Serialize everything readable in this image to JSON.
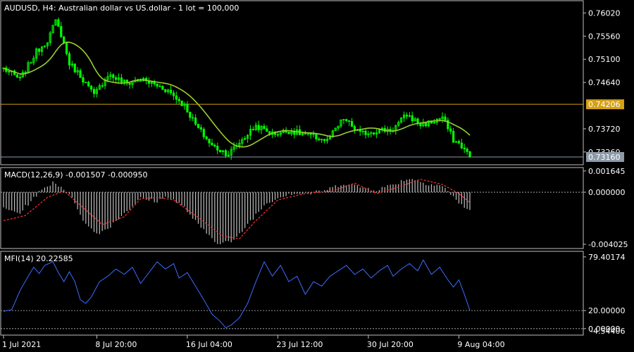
{
  "chart_data": [
    {
      "type": "candlestick",
      "title": "AUDUSD, H4:  Australian dollar vs US.dollar - 1 lot = 100,000",
      "price_ticks": [
        "0.76020",
        "0.75560",
        "0.75100",
        "0.74640",
        "0.73720",
        "0.73260"
      ],
      "price_tick_values": [
        0.7602,
        0.7556,
        0.751,
        0.7464,
        0.7372,
        0.7326
      ],
      "ylim": [
        0.7302,
        0.7625
      ],
      "marker_line": {
        "value": 0.74206,
        "label": "0.74206",
        "color": "#d4a017"
      },
      "current_price": {
        "value": 0.7316,
        "label": "0.73160",
        "color": "#8c9aa8"
      },
      "candle_color": "#00ff00",
      "ma_color": "#9acd32",
      "anchors": [
        {
          "i": 0,
          "p": 0.7492
        },
        {
          "i": 6,
          "p": 0.747
        },
        {
          "i": 12,
          "p": 0.7525
        },
        {
          "i": 16,
          "p": 0.7548
        },
        {
          "i": 19,
          "p": 0.7585
        },
        {
          "i": 21,
          "p": 0.756
        },
        {
          "i": 24,
          "p": 0.7502
        },
        {
          "i": 28,
          "p": 0.7478
        },
        {
          "i": 33,
          "p": 0.7438
        },
        {
          "i": 38,
          "p": 0.748
        },
        {
          "i": 45,
          "p": 0.7462
        },
        {
          "i": 50,
          "p": 0.747
        },
        {
          "i": 56,
          "p": 0.7458
        },
        {
          "i": 60,
          "p": 0.7448
        },
        {
          "i": 66,
          "p": 0.7418
        },
        {
          "i": 70,
          "p": 0.738
        },
        {
          "i": 76,
          "p": 0.7338
        },
        {
          "i": 82,
          "p": 0.7322
        },
        {
          "i": 86,
          "p": 0.7345
        },
        {
          "i": 92,
          "p": 0.7378
        },
        {
          "i": 98,
          "p": 0.7362
        },
        {
          "i": 104,
          "p": 0.7368
        },
        {
          "i": 112,
          "p": 0.7358
        },
        {
          "i": 118,
          "p": 0.7348
        },
        {
          "i": 124,
          "p": 0.7392
        },
        {
          "i": 130,
          "p": 0.7362
        },
        {
          "i": 136,
          "p": 0.7368
        },
        {
          "i": 142,
          "p": 0.7372
        },
        {
          "i": 147,
          "p": 0.74
        },
        {
          "i": 152,
          "p": 0.738
        },
        {
          "i": 156,
          "p": 0.7385
        },
        {
          "i": 160,
          "p": 0.7395
        },
        {
          "i": 164,
          "p": 0.735
        },
        {
          "i": 167,
          "p": 0.7338
        },
        {
          "i": 170,
          "p": 0.7316
        }
      ]
    },
    {
      "type": "histogram",
      "title": "MACD(12,26,9) -0.001507 -0.000950",
      "ticks": [
        "0.001645",
        "0.000000",
        "-0.004025"
      ],
      "tick_values": [
        0.001645,
        0.0,
        -0.004025
      ],
      "ylim": [
        -0.0043,
        0.0018
      ],
      "hist_color": "#c0c0c0",
      "signal_color": "#ff3030",
      "hist_anchors": [
        {
          "i": 0,
          "v": -0.0013
        },
        {
          "i": 6,
          "v": -0.0016
        },
        {
          "i": 12,
          "v": -0.0002
        },
        {
          "i": 18,
          "v": 0.0008
        },
        {
          "i": 22,
          "v": 0.0003
        },
        {
          "i": 26,
          "v": -0.0008
        },
        {
          "i": 30,
          "v": -0.0025
        },
        {
          "i": 34,
          "v": -0.0032
        },
        {
          "i": 38,
          "v": -0.0028
        },
        {
          "i": 44,
          "v": -0.0016
        },
        {
          "i": 50,
          "v": -0.0005
        },
        {
          "i": 56,
          "v": -0.0007
        },
        {
          "i": 60,
          "v": -0.0003
        },
        {
          "i": 66,
          "v": -0.0012
        },
        {
          "i": 72,
          "v": -0.0028
        },
        {
          "i": 78,
          "v": -0.0039
        },
        {
          "i": 84,
          "v": -0.0038
        },
        {
          "i": 90,
          "v": -0.0022
        },
        {
          "i": 96,
          "v": -0.0008
        },
        {
          "i": 104,
          "v": -0.0001
        },
        {
          "i": 112,
          "v": -0.0001
        },
        {
          "i": 118,
          "v": 0.0002
        },
        {
          "i": 124,
          "v": 0.0007
        },
        {
          "i": 130,
          "v": 0.0004
        },
        {
          "i": 136,
          "v": 0.0002
        },
        {
          "i": 142,
          "v": 0.0006
        },
        {
          "i": 148,
          "v": 0.0011
        },
        {
          "i": 154,
          "v": 0.0007
        },
        {
          "i": 160,
          "v": 0.0005
        },
        {
          "i": 164,
          "v": -0.0004
        },
        {
          "i": 170,
          "v": -0.0015
        }
      ],
      "signal_anchors": [
        {
          "i": 0,
          "v": -0.0022
        },
        {
          "i": 8,
          "v": -0.0018
        },
        {
          "i": 16,
          "v": -0.0004
        },
        {
          "i": 22,
          "v": 0.0001
        },
        {
          "i": 28,
          "v": -0.001
        },
        {
          "i": 36,
          "v": -0.0025
        },
        {
          "i": 44,
          "v": -0.0019
        },
        {
          "i": 50,
          "v": -0.0005
        },
        {
          "i": 56,
          "v": -0.0004
        },
        {
          "i": 62,
          "v": -0.0006
        },
        {
          "i": 70,
          "v": -0.0018
        },
        {
          "i": 80,
          "v": -0.0034
        },
        {
          "i": 86,
          "v": -0.0036
        },
        {
          "i": 92,
          "v": -0.0022
        },
        {
          "i": 100,
          "v": -0.0006
        },
        {
          "i": 110,
          "v": -0.0001
        },
        {
          "i": 120,
          "v": 0.0001
        },
        {
          "i": 128,
          "v": 0.0007
        },
        {
          "i": 136,
          "v": -0.0001
        },
        {
          "i": 144,
          "v": 0.0004
        },
        {
          "i": 152,
          "v": 0.001
        },
        {
          "i": 160,
          "v": 0.0006
        },
        {
          "i": 166,
          "v": -0.0001
        },
        {
          "i": 170,
          "v": -0.0008
        }
      ]
    },
    {
      "type": "line",
      "title": "MFI(14) 20.22585",
      "ticks": [
        "79.40174",
        "20.00000",
        "0.00000"
      ],
      "tick_values": [
        79.40174,
        20.0,
        0.0
      ],
      "levels": [
        20.0,
        0.0
      ],
      "ylim": [
        -5.6,
        84
      ],
      "overlap_tick": "-4.54406",
      "line_color": "#3c6bff",
      "anchors": [
        {
          "i": 0,
          "v": 19
        },
        {
          "i": 3,
          "v": 21
        },
        {
          "i": 6,
          "v": 42
        },
        {
          "i": 9,
          "v": 58
        },
        {
          "i": 11,
          "v": 68
        },
        {
          "i": 13,
          "v": 61
        },
        {
          "i": 15,
          "v": 70
        },
        {
          "i": 18,
          "v": 74
        },
        {
          "i": 20,
          "v": 62
        },
        {
          "i": 22,
          "v": 52
        },
        {
          "i": 24,
          "v": 63
        },
        {
          "i": 26,
          "v": 52
        },
        {
          "i": 28,
          "v": 32
        },
        {
          "i": 30,
          "v": 28
        },
        {
          "i": 32,
          "v": 35
        },
        {
          "i": 35,
          "v": 52
        },
        {
          "i": 38,
          "v": 58
        },
        {
          "i": 41,
          "v": 66
        },
        {
          "i": 44,
          "v": 60
        },
        {
          "i": 47,
          "v": 68
        },
        {
          "i": 50,
          "v": 50
        },
        {
          "i": 53,
          "v": 62
        },
        {
          "i": 56,
          "v": 74
        },
        {
          "i": 59,
          "v": 66
        },
        {
          "i": 62,
          "v": 72
        },
        {
          "i": 64,
          "v": 56
        },
        {
          "i": 67,
          "v": 62
        },
        {
          "i": 70,
          "v": 47
        },
        {
          "i": 73,
          "v": 32
        },
        {
          "i": 76,
          "v": 16
        },
        {
          "i": 79,
          "v": 8
        },
        {
          "i": 81,
          "v": 1
        },
        {
          "i": 83,
          "v": 4
        },
        {
          "i": 86,
          "v": 12
        },
        {
          "i": 89,
          "v": 28
        },
        {
          "i": 92,
          "v": 52
        },
        {
          "i": 95,
          "v": 74
        },
        {
          "i": 98,
          "v": 58
        },
        {
          "i": 101,
          "v": 70
        },
        {
          "i": 104,
          "v": 52
        },
        {
          "i": 107,
          "v": 58
        },
        {
          "i": 110,
          "v": 38
        },
        {
          "i": 113,
          "v": 52
        },
        {
          "i": 116,
          "v": 47
        },
        {
          "i": 119,
          "v": 58
        },
        {
          "i": 122,
          "v": 64
        },
        {
          "i": 125,
          "v": 70
        },
        {
          "i": 128,
          "v": 60
        },
        {
          "i": 131,
          "v": 66
        },
        {
          "i": 134,
          "v": 56
        },
        {
          "i": 137,
          "v": 64
        },
        {
          "i": 140,
          "v": 70
        },
        {
          "i": 142,
          "v": 58
        },
        {
          "i": 145,
          "v": 66
        },
        {
          "i": 148,
          "v": 72
        },
        {
          "i": 151,
          "v": 64
        },
        {
          "i": 153,
          "v": 76
        },
        {
          "i": 156,
          "v": 60
        },
        {
          "i": 159,
          "v": 68
        },
        {
          "i": 162,
          "v": 54
        },
        {
          "i": 164,
          "v": 46
        },
        {
          "i": 166,
          "v": 54
        },
        {
          "i": 168,
          "v": 38
        },
        {
          "i": 170,
          "v": 20.2
        }
      ]
    }
  ],
  "time_axis": {
    "bar_count": 171,
    "labels": [
      {
        "i": 0,
        "text": "1 Jul 2021"
      },
      {
        "i": 34,
        "text": "8 Jul 20:00"
      },
      {
        "i": 67,
        "text": "16 Jul 04:00"
      },
      {
        "i": 100,
        "text": "23 Jul 12:00"
      },
      {
        "i": 133,
        "text": "30 Jul 20:00"
      },
      {
        "i": 166,
        "text": "9 Aug 04:00"
      }
    ]
  }
}
